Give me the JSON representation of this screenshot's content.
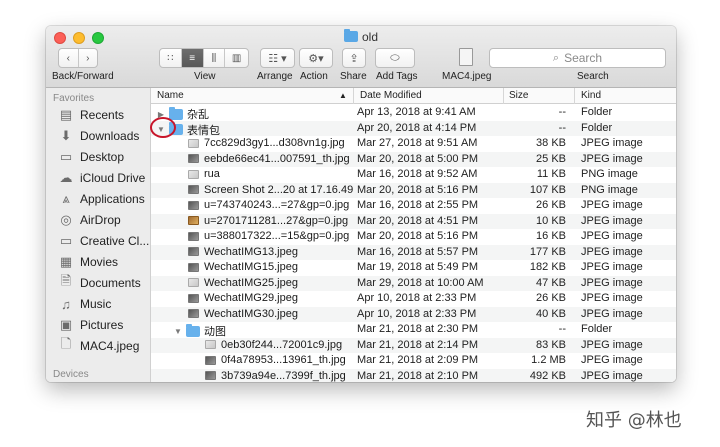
{
  "window": {
    "title": "old"
  },
  "toolbar": {
    "nav_label": "Back/Forward",
    "view_label": "View",
    "arrange_label": "Arrange",
    "action_label": "Action",
    "share_label": "Share",
    "add_tags_label": "Add Tags",
    "file_label": "MAC4.jpeg",
    "search_placeholder": "Search",
    "search_label": "Search"
  },
  "sidebar": {
    "favorites_heading": "Favorites",
    "items": [
      {
        "label": "Recents",
        "icon": "recents-icon"
      },
      {
        "label": "Downloads",
        "icon": "downloads-icon"
      },
      {
        "label": "Desktop",
        "icon": "desktop-icon"
      },
      {
        "label": "iCloud Drive",
        "icon": "cloud-icon"
      },
      {
        "label": "Applications",
        "icon": "applications-icon"
      },
      {
        "label": "AirDrop",
        "icon": "airdrop-icon"
      },
      {
        "label": "Creative Cl...",
        "icon": "folder-icon"
      },
      {
        "label": "Movies",
        "icon": "movies-icon"
      },
      {
        "label": "Documents",
        "icon": "documents-icon"
      },
      {
        "label": "Music",
        "icon": "music-icon"
      },
      {
        "label": "Pictures",
        "icon": "pictures-icon"
      },
      {
        "label": "MAC4.jpeg",
        "icon": "file-icon"
      }
    ],
    "devices_heading": "Devices"
  },
  "columns": {
    "name": "Name",
    "date": "Date Modified",
    "size": "Size",
    "kind": "Kind"
  },
  "rows": [
    {
      "disclosure": "▶",
      "indent": 0,
      "type": "folder",
      "name": "杂乱",
      "date": "Apr 13, 2018 at 9:41 AM",
      "size": "--",
      "kind": "Folder"
    },
    {
      "disclosure": "▼",
      "indent": 0,
      "type": "folder",
      "name": "表情包",
      "date": "Apr 20, 2018 at 4:14 PM",
      "size": "--",
      "kind": "Folder"
    },
    {
      "disclosure": "",
      "indent": 1,
      "type": "img-light",
      "name": "7cc829d3gy1...d308vn1g.jpg",
      "date": "Mar 27, 2018 at 9:51 AM",
      "size": "38 KB",
      "kind": "JPEG image"
    },
    {
      "disclosure": "",
      "indent": 1,
      "type": "img",
      "name": "eebde66ec41...007591_th.jpg",
      "date": "Mar 20, 2018 at 5:00 PM",
      "size": "25 KB",
      "kind": "JPEG image"
    },
    {
      "disclosure": "",
      "indent": 1,
      "type": "img-light",
      "name": "rua",
      "date": "Mar 16, 2018 at 9:52 AM",
      "size": "11 KB",
      "kind": "PNG image"
    },
    {
      "disclosure": "",
      "indent": 1,
      "type": "img",
      "name": "Screen Shot 2...20 at 17.16.49",
      "date": "Mar 20, 2018 at 5:16 PM",
      "size": "107 KB",
      "kind": "PNG image"
    },
    {
      "disclosure": "",
      "indent": 1,
      "type": "img",
      "name": "u=743740243...=27&gp=0.jpg",
      "date": "Mar 16, 2018 at 2:55 PM",
      "size": "26 KB",
      "kind": "JPEG image"
    },
    {
      "disclosure": "",
      "indent": 1,
      "type": "img-warm",
      "name": "u=2701711281...27&gp=0.jpg",
      "date": "Mar 20, 2018 at 4:51 PM",
      "size": "10 KB",
      "kind": "JPEG image"
    },
    {
      "disclosure": "",
      "indent": 1,
      "type": "img",
      "name": "u=388017322...=15&gp=0.jpg",
      "date": "Mar 20, 2018 at 5:16 PM",
      "size": "16 KB",
      "kind": "JPEG image"
    },
    {
      "disclosure": "",
      "indent": 1,
      "type": "img",
      "name": "WechatIMG13.jpeg",
      "date": "Mar 16, 2018 at 5:57 PM",
      "size": "177 KB",
      "kind": "JPEG image"
    },
    {
      "disclosure": "",
      "indent": 1,
      "type": "img",
      "name": "WechatIMG15.jpeg",
      "date": "Mar 19, 2018 at 5:49 PM",
      "size": "182 KB",
      "kind": "JPEG image"
    },
    {
      "disclosure": "",
      "indent": 1,
      "type": "img-light",
      "name": "WechatIMG25.jpeg",
      "date": "Mar 29, 2018 at 10:00 AM",
      "size": "47 KB",
      "kind": "JPEG image"
    },
    {
      "disclosure": "",
      "indent": 1,
      "type": "img",
      "name": "WechatIMG29.jpeg",
      "date": "Apr 10, 2018 at 2:33 PM",
      "size": "26 KB",
      "kind": "JPEG image"
    },
    {
      "disclosure": "",
      "indent": 1,
      "type": "img",
      "name": "WechatIMG30.jpeg",
      "date": "Apr 10, 2018 at 2:33 PM",
      "size": "40 KB",
      "kind": "JPEG image"
    },
    {
      "disclosure": "▼",
      "indent": 1,
      "type": "folder",
      "name": "动图",
      "date": "Mar 21, 2018 at 2:30 PM",
      "size": "--",
      "kind": "Folder"
    },
    {
      "disclosure": "",
      "indent": 2,
      "type": "img-light",
      "name": "0eb30f244...72001c9.jpg",
      "date": "Mar 21, 2018 at 2:14 PM",
      "size": "83 KB",
      "kind": "JPEG image"
    },
    {
      "disclosure": "",
      "indent": 2,
      "type": "img",
      "name": "0f4a78953...13961_th.jpg",
      "date": "Mar 21, 2018 at 2:09 PM",
      "size": "1.2 MB",
      "kind": "JPEG image"
    },
    {
      "disclosure": "",
      "indent": 2,
      "type": "img",
      "name": "3b739a94e...7399f_th.jpg",
      "date": "Mar 21, 2018 at 2:10 PM",
      "size": "492 KB",
      "kind": "JPEG image"
    }
  ],
  "watermark": "知乎 @林也"
}
